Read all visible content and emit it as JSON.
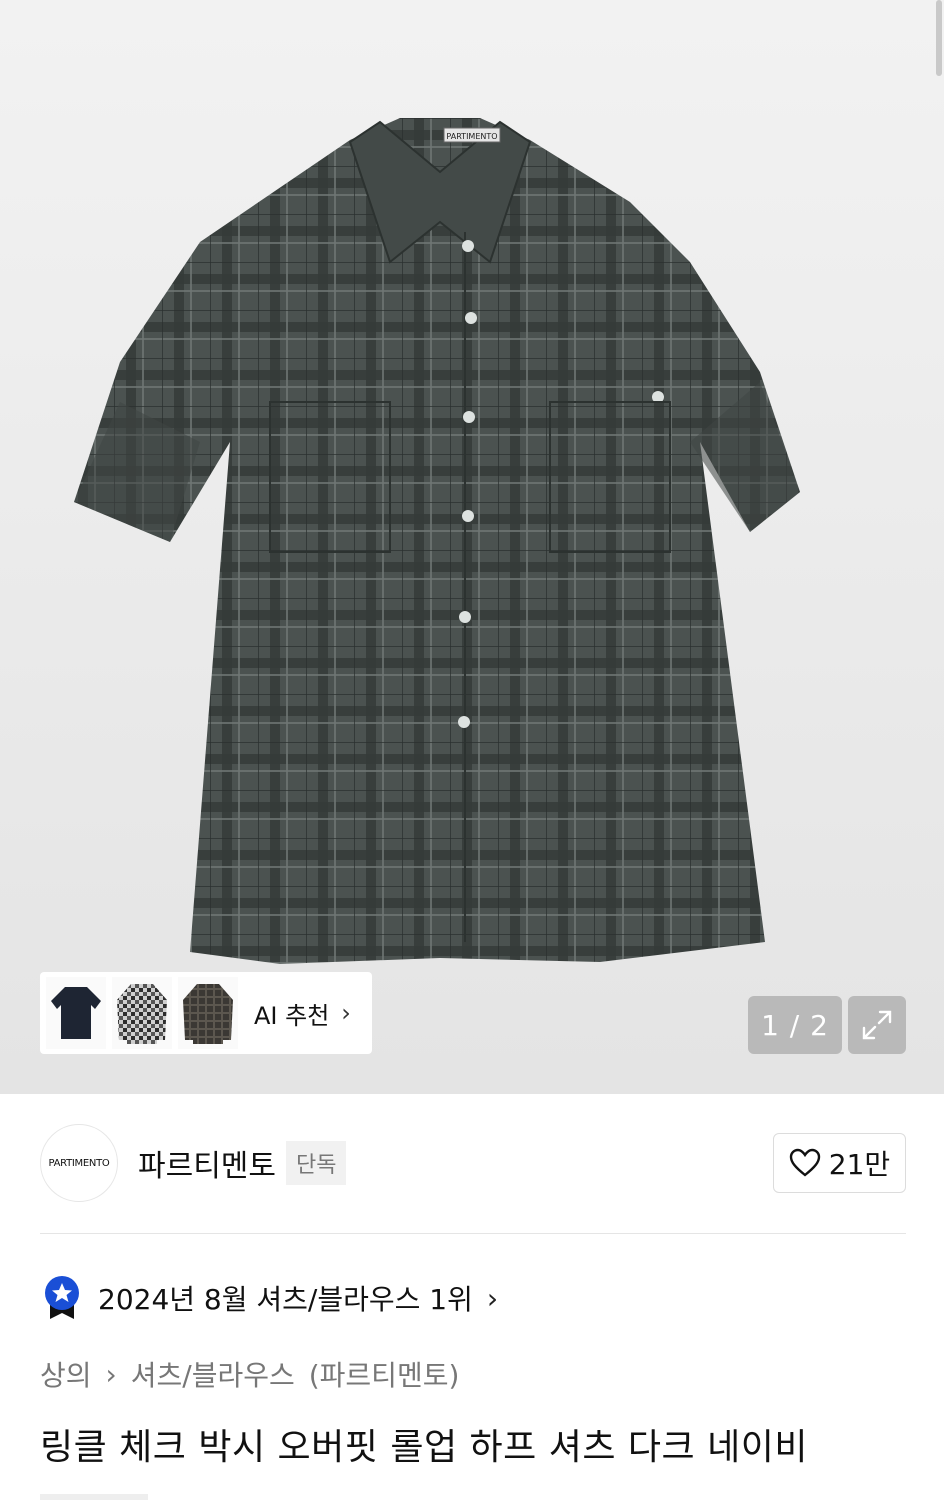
{
  "gallery": {
    "shirt_label": "PARTIMENTO",
    "ai_recommend_label": "AI 추천",
    "page_indicator": "1 / 2",
    "thumbnails": [
      "navy-shirt",
      "check-shirt",
      "dark-check-shirt"
    ]
  },
  "brand": {
    "logo_text": "PARTIMENTO",
    "name": "파르티멘토",
    "badge": "단독",
    "like_count": "21만"
  },
  "ranking": {
    "text": "2024년 8월 셔츠/블라우스 1위"
  },
  "breadcrumb": {
    "level1": "상의",
    "level2": "셔츠/블라우스",
    "level3": "(파르티멘토)"
  },
  "product": {
    "title": "링클 체크 박시 오버핏 롤업 하프 셔츠 다크 네이비"
  },
  "colors": {
    "rank_badge": "#1a4fd6",
    "shirt_base": "#4b5250",
    "check_dark": "#2f3533",
    "check_light": "#6b7370"
  }
}
